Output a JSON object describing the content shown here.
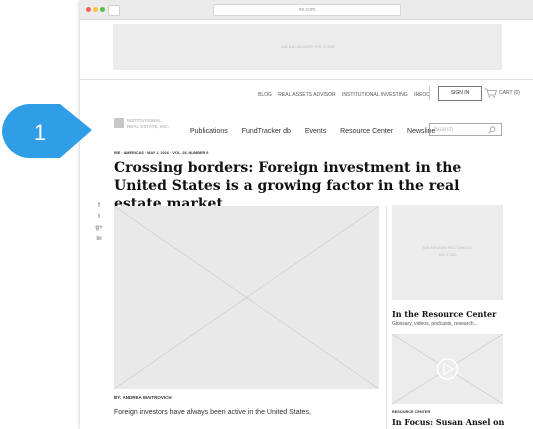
{
  "browser": {
    "url": "ire.com"
  },
  "banner": {
    "text": "IAB BILLBOARD 970 X 250"
  },
  "top_links": [
    "BLOG",
    "REAL ASSETS ADVISOR",
    "INSTITUTIONAL INVESTING",
    "IREOC"
  ],
  "sign_in": "SIGN IN",
  "cart": "CART (0)",
  "logo": {
    "line1": "INSTITUTIONAL",
    "line2": "REAL ESTATE, INC."
  },
  "nav": [
    "Publications",
    "FundTracker db",
    "Events",
    "Resource Center",
    "Newsline"
  ],
  "search": {
    "placeholder": "Search"
  },
  "article": {
    "meta": "IRE · AMERICAS · MAY 1, 2016 · VOL. 28, NUMBER 5",
    "headline": "Crossing borders: Foreign investment in the United States is a growing factor in the real estate market",
    "byline": "BY: ANDREA WAITROVICH",
    "body": "Foreign investors have always been active in the United States,"
  },
  "social": [
    "f",
    "t",
    "g+",
    "in"
  ],
  "sidebar": {
    "ad_line1": "IAB MEDIUM RECTANGLE",
    "ad_line2": "300 X 250",
    "rc_title": "In the Resource Center",
    "rc_sub": "Glossary, videos, podcasts, research...",
    "label": "RESOURCE CENTER",
    "focus_title": "In Focus: Susan Ansel on"
  },
  "callout": {
    "number": "1",
    "color": "#2f9ee6"
  }
}
